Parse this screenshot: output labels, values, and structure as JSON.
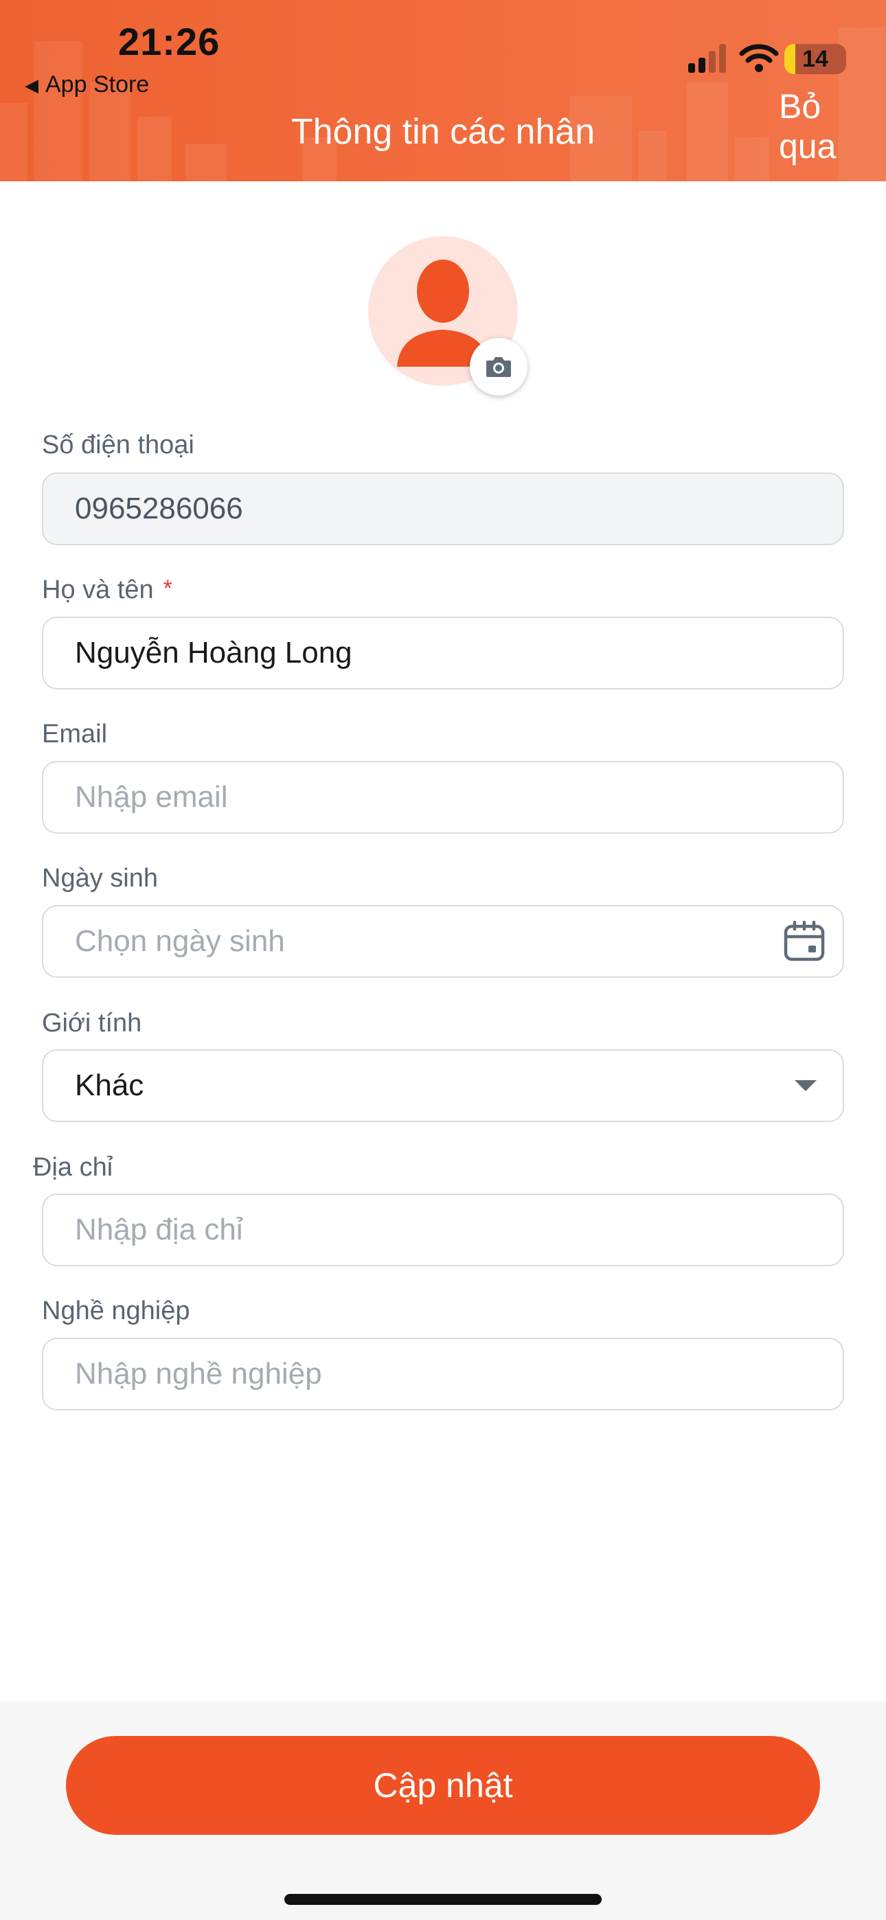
{
  "status_bar": {
    "time": "21:26",
    "back_label": "App Store",
    "battery": "14"
  },
  "header": {
    "title": "Thông tin các nhân",
    "skip_label": "Bỏ qua"
  },
  "form": {
    "phone": {
      "label": "Số điện thoại",
      "value": "0965286066"
    },
    "name": {
      "label": "Họ và tên",
      "required_mark": "*",
      "value": "Nguyễn Hoàng Long"
    },
    "email": {
      "label": "Email",
      "placeholder": "Nhập email"
    },
    "birthday": {
      "label": "Ngày sinh",
      "placeholder": "Chọn ngày sinh"
    },
    "gender": {
      "label": "Giới tính",
      "value": "Khác"
    },
    "address": {
      "label": "Địa chỉ",
      "placeholder": "Nhập địa chỉ"
    },
    "job": {
      "label": "Nghề nghiệp",
      "placeholder": "Nhập nghề nghiệp"
    }
  },
  "actions": {
    "update_label": "Cập nhật"
  },
  "icons": {
    "avatar": "user-avatar-icon",
    "camera": "camera-icon",
    "calendar": "calendar-icon",
    "dropdown": "caret-down-icon"
  },
  "colors": {
    "accent": "#f05124",
    "header": "#ef6535",
    "avatar_bg": "#fde3dc"
  }
}
